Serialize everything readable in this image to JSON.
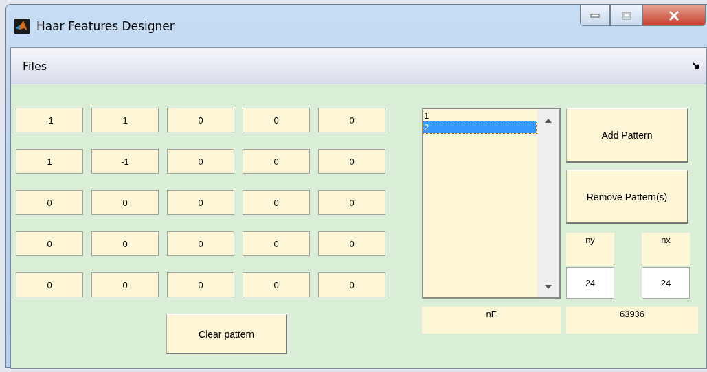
{
  "window": {
    "title": "Haar Features Designer"
  },
  "menu": [
    {
      "label": "Files"
    }
  ],
  "pattern": [
    [
      "-1",
      "1",
      "0",
      "0",
      "0"
    ],
    [
      "1",
      "-1",
      "0",
      "0",
      "0"
    ],
    [
      "0",
      "0",
      "0",
      "0",
      "0"
    ],
    [
      "0",
      "0",
      "0",
      "0",
      "0"
    ],
    [
      "0",
      "0",
      "0",
      "0",
      "0"
    ]
  ],
  "clear_button": "Clear pattern",
  "pattern_list": [
    {
      "label": "1",
      "selected": false
    },
    {
      "label": "2",
      "selected": true
    }
  ],
  "add_button": "Add Pattern",
  "remove_button": "Remove Pattern(s)",
  "ny": {
    "label": "ny",
    "value": "24"
  },
  "nx": {
    "label": "nx",
    "value": "24"
  },
  "nf": {
    "label": "nF",
    "value": "63936"
  }
}
